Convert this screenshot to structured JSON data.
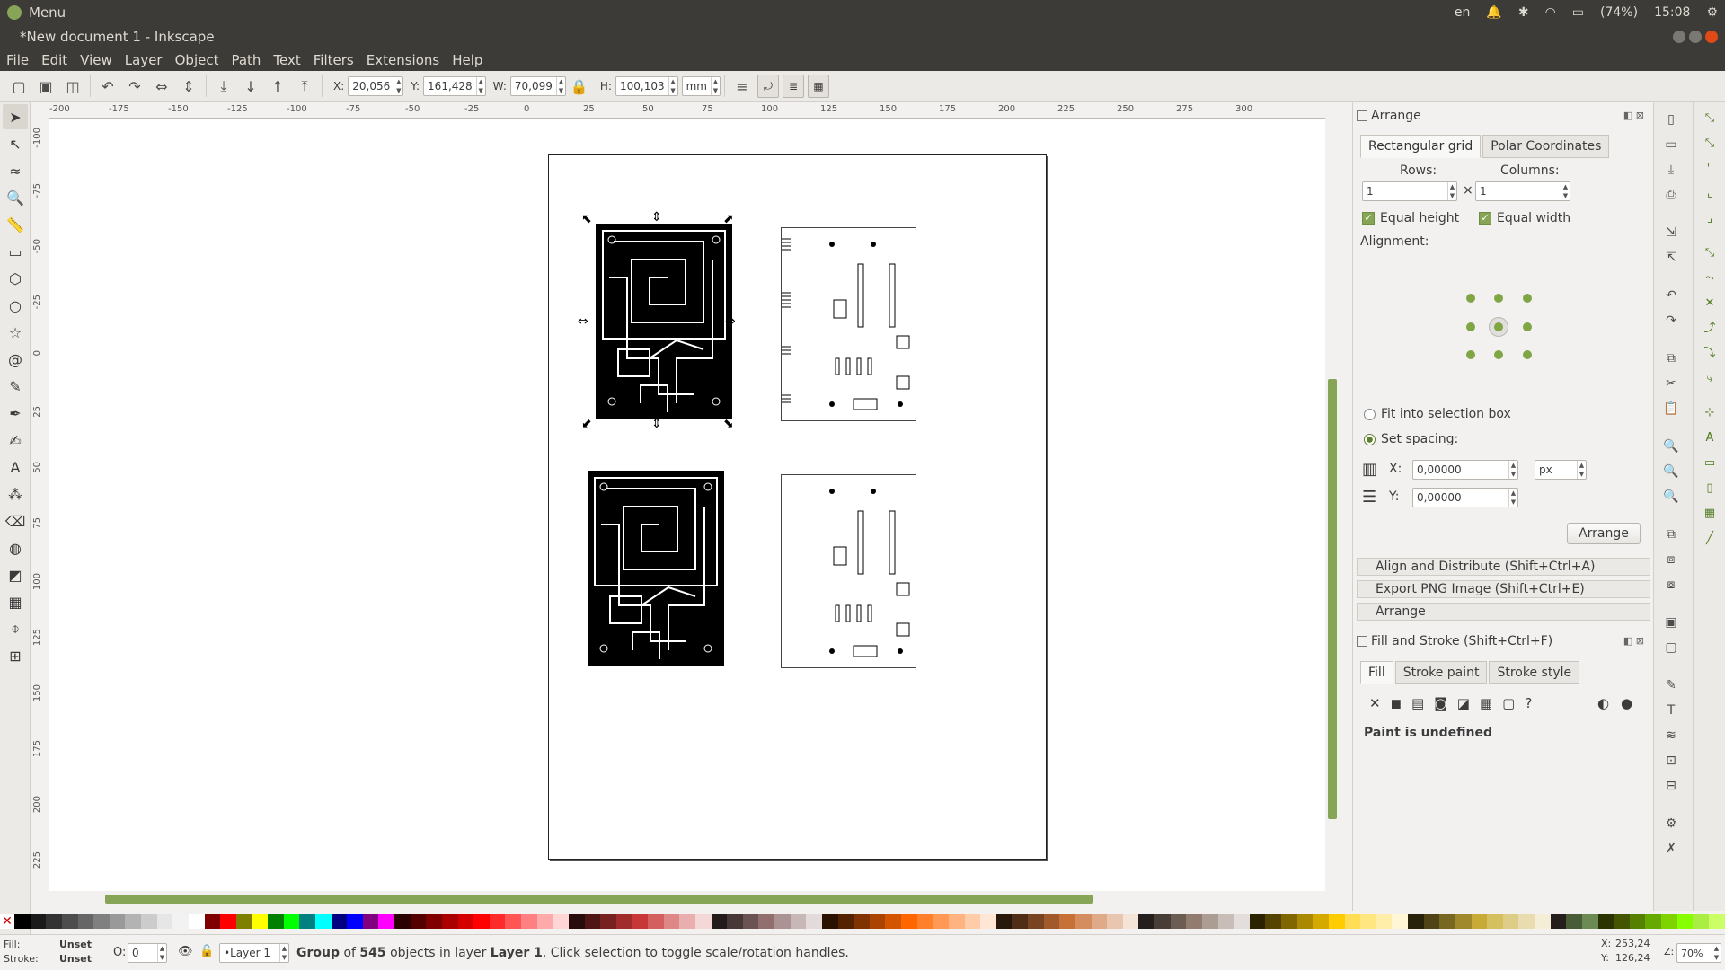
{
  "system": {
    "menu_label": "Menu",
    "lang": "en",
    "battery": "(74%)",
    "time": "15:08"
  },
  "window": {
    "title": "*New document 1 - Inkscape"
  },
  "menubar": [
    "File",
    "Edit",
    "View",
    "Layer",
    "Object",
    "Path",
    "Text",
    "Filters",
    "Extensions",
    "Help"
  ],
  "controls": {
    "x_label": "X:",
    "x_value": "20,056",
    "y_label": "Y:",
    "y_value": "161,428",
    "w_label": "W:",
    "w_value": "70,099",
    "h_label": "H:",
    "h_value": "100,103",
    "unit": "mm"
  },
  "ruler": {
    "h_ticks": [
      "-200",
      "-175",
      "-150",
      "-125",
      "-100",
      "-75",
      "-50",
      "-25",
      "0",
      "25",
      "50",
      "75",
      "100",
      "125",
      "150",
      "175",
      "200",
      "225",
      "250",
      "275",
      "300"
    ],
    "v_ticks": [
      "-100",
      "-75",
      "-50",
      "-25",
      "0",
      "25",
      "50",
      "75",
      "100",
      "125",
      "150",
      "175",
      "200",
      "225"
    ]
  },
  "arrange": {
    "title": "Arrange",
    "tab_rect": "Rectangular grid",
    "tab_polar": "Polar Coordinates",
    "rows_label": "Rows:",
    "columns_label": "Columns:",
    "times": "×",
    "rows_value": "1",
    "columns_value": "1",
    "equal_height": "Equal height",
    "equal_width": "Equal width",
    "alignment_label": "Alignment:",
    "fit_label": "Fit into selection box",
    "spacing_label": "Set spacing:",
    "x_label": "X:",
    "x_value": "0,00000",
    "y_label": "Y:",
    "y_value": "0,00000",
    "spacing_unit": "px",
    "arrange_button": "Arrange"
  },
  "collapsed_panels": [
    "Align and Distribute (Shift+Ctrl+A)",
    "Export PNG Image (Shift+Ctrl+E)",
    "Arrange"
  ],
  "fill_stroke": {
    "title": "Fill and Stroke (Shift+Ctrl+F)",
    "tab_fill": "Fill",
    "tab_stroke_paint": "Stroke paint",
    "tab_stroke_style": "Stroke style",
    "paint_status": "Paint is undefined",
    "unset_symbol": "?"
  },
  "status": {
    "fill_label": "Fill:",
    "fill_value": "Unset",
    "stroke_label": "Stroke:",
    "stroke_value": "Unset",
    "opacity_label": "O:",
    "opacity_value": "0",
    "layer": "•Layer 1",
    "msg_group": "Group",
    "msg_of": " of ",
    "msg_count": "545",
    "msg_in_layer": " objects in layer ",
    "msg_layer_name": "Layer 1",
    "msg_rest": ". Click selection to toggle scale/rotation handles.",
    "coord_x_label": "X:",
    "coord_x": "253,24",
    "coord_y_label": "Y:",
    "coord_y": "126,24",
    "zoom_label": "Z:",
    "zoom": "70%"
  },
  "palette": [
    "#000000",
    "#1a1a1a",
    "#333333",
    "#4d4d4d",
    "#666666",
    "#808080",
    "#999999",
    "#b3b3b3",
    "#cccccc",
    "#e6e6e6",
    "#f2f2f2",
    "#ffffff",
    "#800000",
    "#ff0000",
    "#808000",
    "#ffff00",
    "#008000",
    "#00ff00",
    "#008080",
    "#00ffff",
    "#000080",
    "#0000ff",
    "#800080",
    "#ff00ff",
    "#2b0000",
    "#550000",
    "#800000",
    "#aa0000",
    "#d40000",
    "#ff0000",
    "#ff2a2a",
    "#ff5555",
    "#ff8080",
    "#ffaaaa",
    "#ffd5d5",
    "#280b0b",
    "#501616",
    "#782121",
    "#a02c2c",
    "#c83737",
    "#d35f5f",
    "#de8787",
    "#e9afaf",
    "#f4d7d7",
    "#241c1c",
    "#483737",
    "#6c5353",
    "#916f6f",
    "#ac9393",
    "#c8b7b7",
    "#e3dbdb",
    "#2b1100",
    "#552200",
    "#803300",
    "#aa4400",
    "#d45500",
    "#ff6600",
    "#ff7f2a",
    "#ff9955",
    "#ffb380",
    "#ffccaa",
    "#ffe6d5",
    "#28170b",
    "#502d16",
    "#784421",
    "#a05a2c",
    "#c87137",
    "#d38d5f",
    "#deaa87",
    "#e9c6af",
    "#f4e3d7",
    "#241f1c",
    "#483e37",
    "#6c5d53",
    "#917c6f",
    "#ac9d93",
    "#c8beb7",
    "#e3dedb",
    "#2b2200",
    "#554400",
    "#806600",
    "#aa8800",
    "#d4aa00",
    "#ffcc00",
    "#ffdd55",
    "#ffe680",
    "#ffeeaa",
    "#fff6d5",
    "#28220b",
    "#504416",
    "#786721",
    "#a0892c",
    "#c8ab37",
    "#d4c05f",
    "#decd87",
    "#e9ddaf",
    "#f4eed7",
    "#241f1c",
    "#485d37",
    "#6c8a53",
    "#2b3300",
    "#445500",
    "#558000",
    "#66aa00",
    "#7fd400",
    "#88ff00",
    "#aaee44",
    "#ccff66"
  ]
}
